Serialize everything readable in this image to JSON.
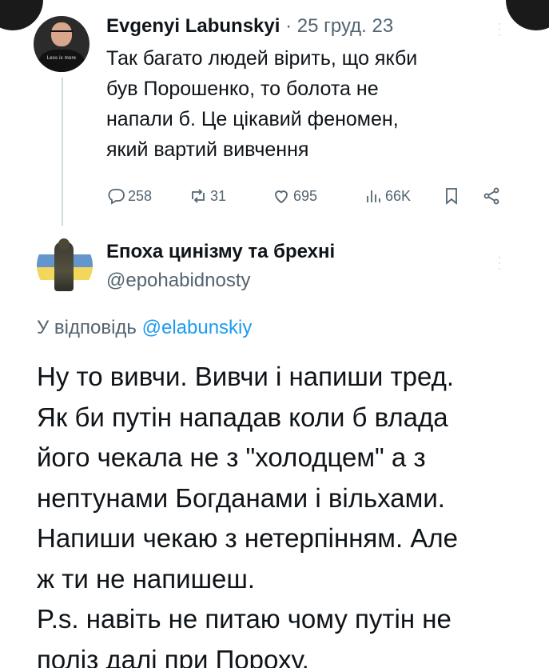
{
  "tweet1": {
    "author_name": "Evgenyi Labunskyi",
    "separator": "·",
    "date": "25 груд. 23",
    "avatar_shirt_text": "Less is more",
    "lines": [
      "Так багато людей вірить, що якби",
      "був Порошенко, то болота не",
      "напали б. Це цікавий феномен,",
      "який вартий вивчення"
    ],
    "stats": {
      "replies": "258",
      "reposts": "31",
      "likes": "695",
      "views": "66K"
    }
  },
  "tweet2": {
    "author_name": "Епоха цинізму та брехні",
    "handle": "@epohabidnosty",
    "reply_prefix": "У відповідь",
    "reply_mention": "@elabunskiy",
    "lines": [
      "Ну то вивчи. Вивчи і напиши тред.",
      "Як би путін нападав коли б влада",
      "його чекала не з \"холодцем\" а з",
      "нептунами Богданами і вільхами.",
      "Напиши чекаю з нетерпінням. Але",
      "ж ти не напишеш.",
      "P.s. навіть не питаю чому путін не",
      "поліз далі при Пороху."
    ]
  },
  "icons": [
    "close-icon",
    "more-icon",
    "reply-icon",
    "repost-icon",
    "like-icon",
    "views-icon",
    "bookmark-icon",
    "share-icon"
  ],
  "colors": {
    "text": "#0f1419",
    "secondary": "#536471",
    "link": "#1d9bf0",
    "thread_line": "#cfd9de"
  }
}
